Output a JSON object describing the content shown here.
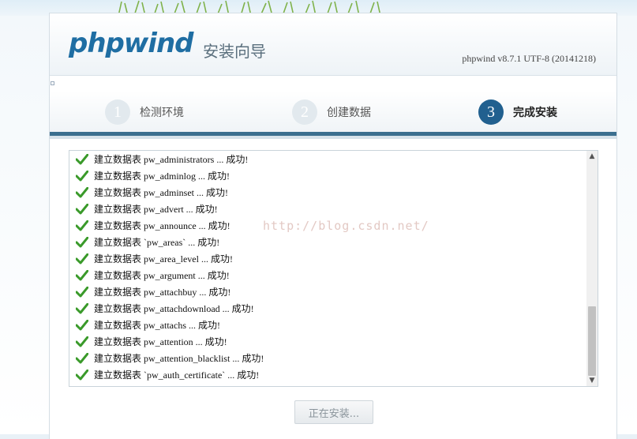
{
  "header": {
    "logo_text": "phpwind",
    "subtitle": "安装向导",
    "version": "phpwind v8.7.1 UTF-8 (20141218)"
  },
  "steps": [
    {
      "number": "1",
      "label": "检测环境",
      "active": false
    },
    {
      "number": "2",
      "label": "创建数据",
      "active": false
    },
    {
      "number": "3",
      "label": "完成安装",
      "active": true
    }
  ],
  "log": {
    "items": [
      "建立数据表 pw_administrators ... 成功!",
      "建立数据表 pw_adminlog ... 成功!",
      "建立数据表 pw_adminset ... 成功!",
      "建立数据表 pw_advert ... 成功!",
      "建立数据表 pw_announce ... 成功!",
      "建立数据表 `pw_areas` ... 成功!",
      "建立数据表 pw_area_level ... 成功!",
      "建立数据表 pw_argument ... 成功!",
      "建立数据表 pw_attachbuy ... 成功!",
      "建立数据表 pw_attachdownload ... 成功!",
      "建立数据表 pw_attachs ... 成功!",
      "建立数据表 pw_attention ... 成功!",
      "建立数据表 pw_attention_blacklist ... 成功!",
      "建立数据表 `pw_auth_certificate` ... 成功!"
    ],
    "icon": "check-icon",
    "check_color": "#3a9a2a",
    "watermark": "http://blog.csdn.net/"
  },
  "install_button": {
    "label": "正在安装..."
  }
}
